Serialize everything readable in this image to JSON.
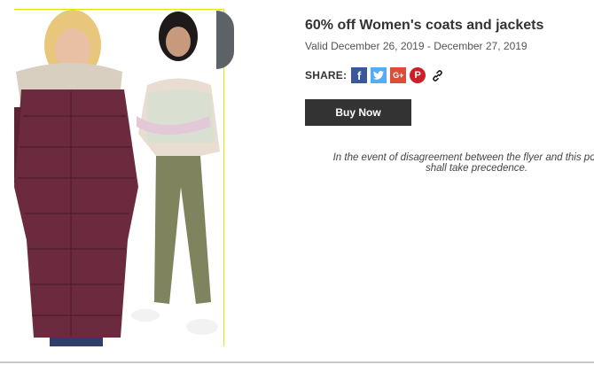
{
  "product": {
    "title": "60% off Women's coats and jackets",
    "validity": "Valid December 26, 2019 - December 27, 2019",
    "image_alt": "Women wearing a plum puffer coat and a pastel knit sweater with olive pants",
    "buy_label": "Buy Now"
  },
  "share": {
    "label": "SHARE:",
    "buttons": [
      {
        "name": "facebook",
        "icon": "facebook-icon",
        "glyph": "f",
        "color": "#3b5998"
      },
      {
        "name": "twitter",
        "icon": "twitter-icon",
        "glyph": "t",
        "color": "#55acee"
      },
      {
        "name": "google-plus",
        "icon": "google-plus-icon",
        "glyph": "G+",
        "color": "#dd4b39"
      },
      {
        "name": "pinterest",
        "icon": "pinterest-icon",
        "glyph": "P",
        "color": "#cb2027"
      },
      {
        "name": "copy-link",
        "icon": "link-icon",
        "glyph": "",
        "color": "#000000"
      }
    ]
  },
  "disclaimer": {
    "line1": "In the event of disagreement between the flyer and this popu",
    "line2": "shall take precedence."
  },
  "colors": {
    "coat": "#6b2a3d",
    "button_bg": "#333333",
    "image_border": "#e3e400"
  }
}
